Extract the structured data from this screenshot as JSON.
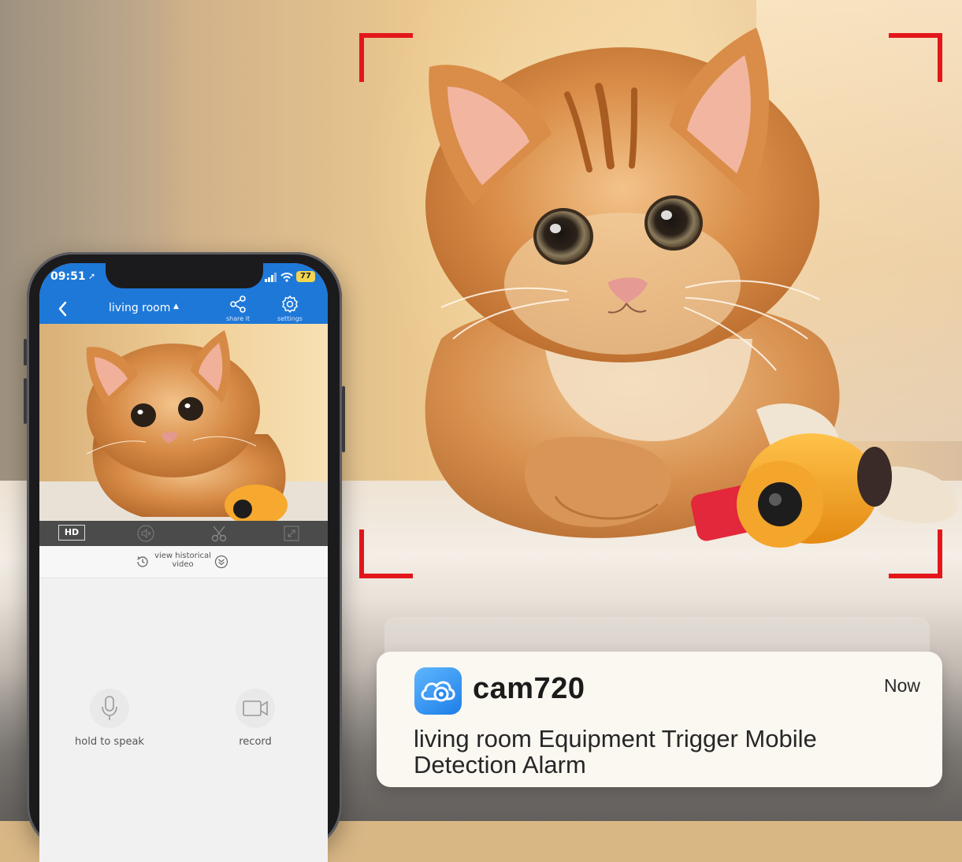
{
  "phone": {
    "status": {
      "time": "09:51",
      "battery": "77"
    },
    "header": {
      "title": "living room",
      "share_label": "share it",
      "settings_label": "settings"
    },
    "toolbar": {
      "hd_label": "HD"
    },
    "history": {
      "label": "view historical video"
    },
    "controls": {
      "speak_label": "hold to speak",
      "record_label": "record"
    }
  },
  "notification": {
    "app_name": "cam720",
    "time": "Now",
    "message": "living room Equipment Trigger Mobile Detection Alarm"
  },
  "colors": {
    "app_blue": "#1e78d8",
    "bracket_red": "#e3171b"
  },
  "icons": [
    "back-arrow-icon",
    "share-icon",
    "gear-icon",
    "speaker-mute-icon",
    "scissors-icon",
    "fullscreen-icon",
    "history-clock-icon",
    "chevron-down-circle-icon",
    "microphone-icon",
    "video-camera-icon",
    "cloud-camera-icon"
  ]
}
